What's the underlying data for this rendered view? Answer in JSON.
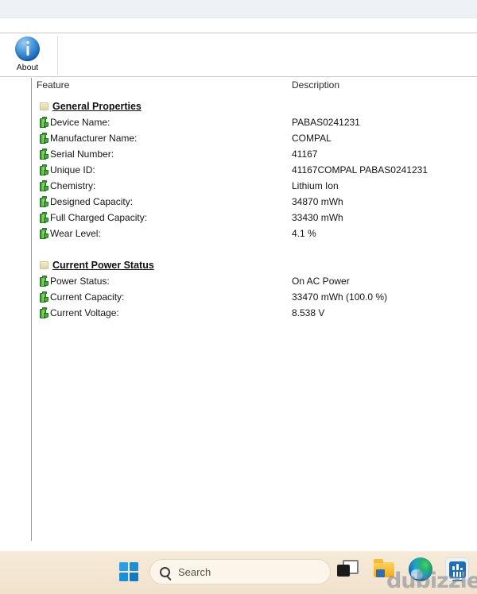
{
  "window": {
    "toolbar": {
      "about_label": "About",
      "about_icon": "info-circle-icon"
    }
  },
  "list": {
    "columns": {
      "feature": "Feature",
      "description": "Description"
    },
    "groups": [
      {
        "label": "General Properties",
        "icon": "folder-icon",
        "rows": [
          {
            "feature": "Device Name:",
            "value": "PABAS0241231"
          },
          {
            "feature": "Manufacturer Name:",
            "value": "COMPAL"
          },
          {
            "feature": "Serial Number:",
            "value": "41167"
          },
          {
            "feature": "Unique ID:",
            "value": "41167COMPAL PABAS0241231"
          },
          {
            "feature": "Chemistry:",
            "value": "Lithium Ion"
          },
          {
            "feature": "Designed Capacity:",
            "value": "34870 mWh"
          },
          {
            "feature": "Full Charged Capacity:",
            "value": "33430 mWh"
          },
          {
            "feature": "Wear Level:",
            "value": "4.1 %"
          }
        ]
      },
      {
        "label": "Current Power Status",
        "icon": "folder-icon",
        "rows": [
          {
            "feature": "Power Status:",
            "value": "On AC Power"
          },
          {
            "feature": "Current Capacity:",
            "value": "33470 mWh (100.0 %)"
          },
          {
            "feature": "Current Voltage:",
            "value": "8.538 V"
          }
        ]
      }
    ]
  },
  "taskbar": {
    "start_label": "start-icon",
    "search_placeholder": "Search",
    "search_value": "",
    "icons": [
      {
        "name": "task-view-icon"
      },
      {
        "name": "file-explorer-icon"
      },
      {
        "name": "microsoft-edge-icon"
      },
      {
        "name": "battery-info-app-icon"
      }
    ]
  },
  "watermark": {
    "text": "dubizzle"
  }
}
